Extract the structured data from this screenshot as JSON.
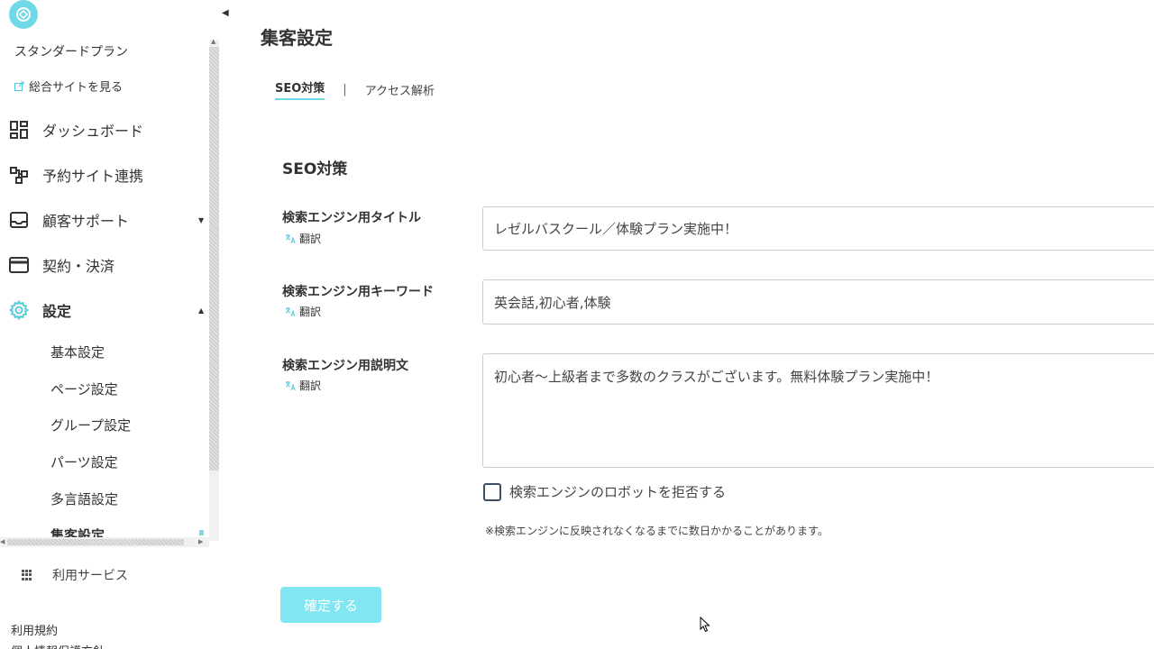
{
  "sidebar": {
    "plan_name": "スタンダードプラン",
    "site_link": "総合サイトを見る",
    "nav": [
      {
        "label": "ダッシュボード",
        "icon": "dashboard-icon"
      },
      {
        "label": "予約サイト連携",
        "icon": "site-link-icon"
      },
      {
        "label": "顧客サポート",
        "icon": "inbox-icon"
      },
      {
        "label": "契約・決済",
        "icon": "credit-card-icon"
      },
      {
        "label": "設定",
        "icon": "gear-icon"
      }
    ],
    "settings_sub": [
      {
        "label": "基本設定"
      },
      {
        "label": "ページ設定"
      },
      {
        "label": "グループ設定"
      },
      {
        "label": "パーツ設定"
      },
      {
        "label": "多言語設定"
      },
      {
        "label": "集客設定"
      }
    ],
    "services": "利用サービス",
    "footer": [
      "利用規約",
      "個人情報保護方針"
    ]
  },
  "main": {
    "title": "集客設定",
    "tabs": [
      {
        "label": "SEO対策",
        "active": true
      },
      {
        "label": "アクセス解析",
        "active": false
      }
    ],
    "tab_separator": "|",
    "section_title": "SEO対策",
    "translate_label": "翻訳",
    "fields": {
      "title": {
        "label": "検索エンジン用タイトル",
        "value": "レゼルバスクール／体験プラン実施中！"
      },
      "keywords": {
        "label": "検索エンジン用キーワード",
        "value": "英会話,初心者,体験"
      },
      "description": {
        "label": "検索エンジン用説明文",
        "value": "初心者～上級者まで多数のクラスがございます。無料体験プラン実施中！"
      }
    },
    "robots_checkbox": {
      "label": "検索エンジンのロボットを拒否する",
      "checked": false
    },
    "note": "※検索エンジンに反映されなくなるまでに数日かかることがあります。",
    "confirm_button": "確定する"
  },
  "colors": {
    "accent": "#6fd9e8",
    "button": "#7fe6f2",
    "text": "#333333"
  }
}
